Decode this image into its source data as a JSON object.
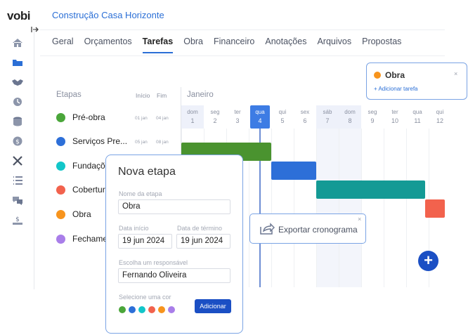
{
  "app": {
    "logo": "vobi",
    "project_title": "Construção Casa Horizonte"
  },
  "tabs": [
    "Geral",
    "Orçamentos",
    "Tarefas",
    "Obra",
    "Financeiro",
    "Anotações",
    "Arquivos",
    "Propostas"
  ],
  "active_tab": "Tarefas",
  "table": {
    "col_etapas": "Etapas",
    "col_inicio": "Início",
    "col_fim": "Fim",
    "stages": [
      {
        "name": "Pré-obra",
        "color": "#4aa63a",
        "inicio": "01 jan",
        "fim": "04 jan"
      },
      {
        "name": "Serviços Pre...",
        "color": "#2d6fd8",
        "inicio": "05 jan",
        "fim": "08 jan"
      },
      {
        "name": "Fundações",
        "color": "#12c6c9",
        "inicio": "",
        "fim": ""
      },
      {
        "name": "Coberturas",
        "color": "#f2624d",
        "inicio": "",
        "fim": ""
      },
      {
        "name": "Obra",
        "color": "#f7941d",
        "inicio": "",
        "fim": ""
      },
      {
        "name": "Fechamento",
        "color": "#a97ee9",
        "inicio": "",
        "fim": ""
      }
    ]
  },
  "gantt": {
    "month": "Janeiro",
    "days": [
      {
        "wd": "dom",
        "n": "1"
      },
      {
        "wd": "seg",
        "n": "2"
      },
      {
        "wd": "ter",
        "n": "3"
      },
      {
        "wd": "qua",
        "n": "4"
      },
      {
        "wd": "qui",
        "n": "5"
      },
      {
        "wd": "sex",
        "n": "6"
      },
      {
        "wd": "sáb",
        "n": "7"
      },
      {
        "wd": "dom",
        "n": "8"
      },
      {
        "wd": "seg",
        "n": "9"
      },
      {
        "wd": "ter",
        "n": "10"
      },
      {
        "wd": "qua",
        "n": "11"
      },
      {
        "wd": "qui",
        "n": "12"
      }
    ],
    "today": "4",
    "bars": [
      {
        "stage": "Pré-obra",
        "color": "#4a932f"
      },
      {
        "stage": "Serviços Pre...",
        "color": "#2d6fd8"
      },
      {
        "stage": "Fundações",
        "color": "#149a95"
      },
      {
        "stage": "Coberturas",
        "color": "#f2624d"
      }
    ]
  },
  "obra_card": {
    "name": "Obra",
    "color": "#f7941d",
    "add_task": "+ Adicionar tarefa",
    "close": "×"
  },
  "export": {
    "label": "Exportar cronograma",
    "close": "×"
  },
  "fab": "+",
  "modal": {
    "title": "Nova etapa",
    "name_label": "Nome da etapa",
    "name_value": "Obra",
    "start_label": "Data início",
    "start_value": "19 jun 2024",
    "end_label": "Data de término",
    "end_value": "19 jun 2024",
    "owner_label": "Escolha um responsável",
    "owner_value": "Fernando Oliveira",
    "color_label": "Selecione uma cor",
    "colors": [
      "#4aa63a",
      "#2d6fd8",
      "#12c6c9",
      "#f2624d",
      "#f7941d",
      "#a97ee9"
    ],
    "add_button": "Adicionar"
  },
  "sidebar_icons": [
    "home-icon",
    "folder-icon",
    "handshake-icon",
    "clock-icon",
    "database-icon",
    "dollar-icon",
    "tools-icon",
    "list-icon",
    "chat-icon",
    "money-hand-icon"
  ]
}
